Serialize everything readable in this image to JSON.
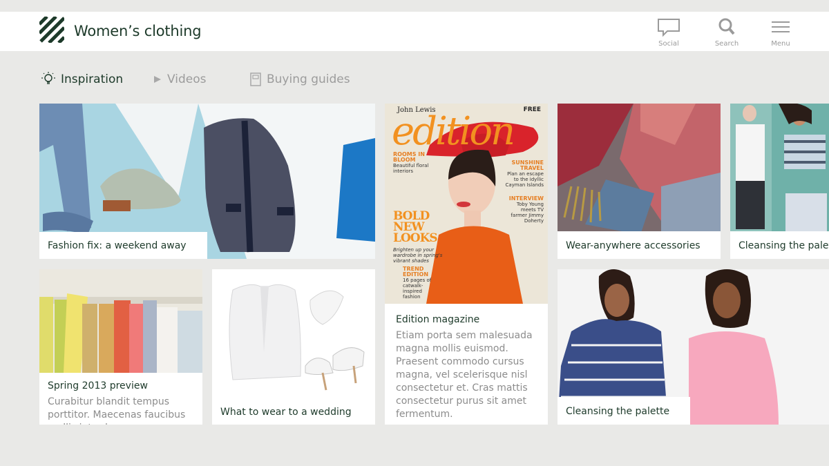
{
  "app": {
    "title": "Women’s clothing",
    "accent_color": "#1d3a2a"
  },
  "header_actions": [
    {
      "label": "Social",
      "icon": "speech-bubble-icon"
    },
    {
      "label": "Search",
      "icon": "magnifier-icon"
    },
    {
      "label": "Menu",
      "icon": "hamburger-icon"
    }
  ],
  "tabs": [
    {
      "label": "Inspiration",
      "icon": "lightbulb-icon",
      "active": true
    },
    {
      "label": "Videos",
      "icon": "play-icon",
      "active": false
    },
    {
      "label": "Buying guides",
      "icon": "book-icon",
      "active": false
    }
  ],
  "tiles": [
    {
      "title": "Fashion fix: a weekend away"
    },
    {
      "title": "Edition magazine",
      "description": "Etiam porta sem malesuada magna mollis euismod. Praesent commodo cursus magna, vel scelerisque nisl consectetur et. Cras mattis consectetur purus sit amet fermentum."
    },
    {
      "title": "Wear-anywhere accessories"
    },
    {
      "title": "Cleansing the palette"
    },
    {
      "title": "Spring 2013 preview",
      "description": "Curabitur blandit tempus porttitor. Maecenas faucibus mollis interdum."
    },
    {
      "title": "What to wear to a wedding"
    },
    {
      "title": "Cleansing the palette"
    }
  ],
  "magazine_cover": {
    "brand": "John Lewis",
    "free": "FREE",
    "title": "edition",
    "left_heading": "ROOMS IN BLOOM",
    "left_text": "Beautiful floral interiors",
    "right_heading_1": "SUNSHINE TRAVEL",
    "right_text_1": "Plan an escape to the idyllic Cayman Islands",
    "right_heading_2": "INTERVIEW",
    "right_text_2": "Toby Young meets TV farmer Jimmy Doherty",
    "big_line": "BOLD NEW LOOKS",
    "big_sub": "Brighten up your wardrobe in spring's vibrant shades",
    "trend_heading": "TREND EDITION",
    "trend_text": "16 pages of catwalk-inspired fashion"
  }
}
